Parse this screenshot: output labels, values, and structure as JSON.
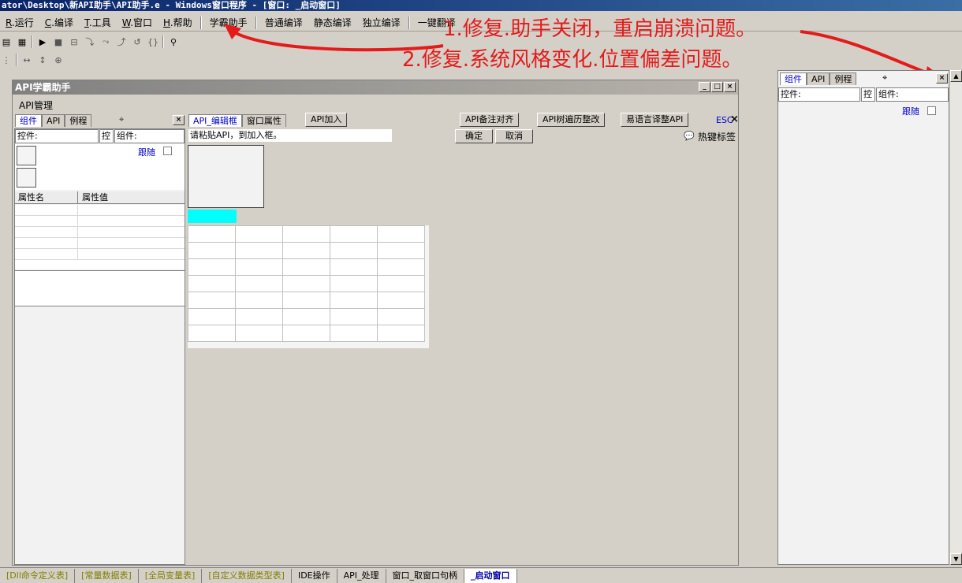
{
  "window": {
    "title": "ator\\Desktop\\新API助手\\API助手.e - Windows窗口程序 - [窗口: _启动窗口]"
  },
  "menubar": {
    "items": [
      {
        "key": "R",
        "label": ".运行"
      },
      {
        "key": "C",
        "label": ".编译"
      },
      {
        "key": "T",
        "label": ".工具"
      },
      {
        "key": "W",
        "label": ".窗口"
      },
      {
        "key": "H",
        "label": ".帮助"
      }
    ],
    "extras": [
      "学霸助手",
      "普通编译",
      "静态编译",
      "独立编译",
      "一键翻译"
    ]
  },
  "annotations": {
    "line1": "1.修复.助手关闭，重启崩溃问题。",
    "line2": "2.修复.系统风格变化.位置偏差问题。"
  },
  "helper_window": {
    "title": "API学霸助手",
    "menu_label": "API管理",
    "left_tabs": [
      "组件",
      "API",
      "例程"
    ],
    "control_label": "控件:",
    "control_short": "控",
    "component_label": "组件:",
    "follow_label": "跟随",
    "prop_headers": [
      "属性名",
      "属性值"
    ],
    "right_tabs": [
      "API_编辑框",
      "窗口属性"
    ],
    "api_add_button": "API加入",
    "buttons": [
      "API备注对齐",
      "API树遍历整改",
      "易语言译整API"
    ],
    "esc_label": "ESC",
    "paste_placeholder": "请粘贴API，到加入框。",
    "confirm_button": "确定",
    "cancel_button": "取消",
    "hotkey_label": "热键标签"
  },
  "right_panel": {
    "tabs": [
      "组件",
      "API",
      "例程"
    ],
    "control_label": "控件:",
    "control_short": "控",
    "component_label": "组件:",
    "follow_label": "跟随"
  },
  "bottom_tabs": [
    {
      "label": "[Dll命令定义表]",
      "style": "olive"
    },
    {
      "label": "[常量数据表]",
      "style": "olive"
    },
    {
      "label": "[全局变量表]",
      "style": "olive"
    },
    {
      "label": "[自定义数据类型表]",
      "style": "olive"
    },
    {
      "label": "IDE操作",
      "style": "normal"
    },
    {
      "label": "API_处理",
      "style": "normal"
    },
    {
      "label": "窗口_取窗口句柄",
      "style": "normal"
    },
    {
      "label": "_启动窗口",
      "style": "active"
    }
  ],
  "colors": {
    "annotation": "#e31b1b",
    "cyan_block": "#00ffff",
    "active_tab_text": "#0000cc"
  }
}
